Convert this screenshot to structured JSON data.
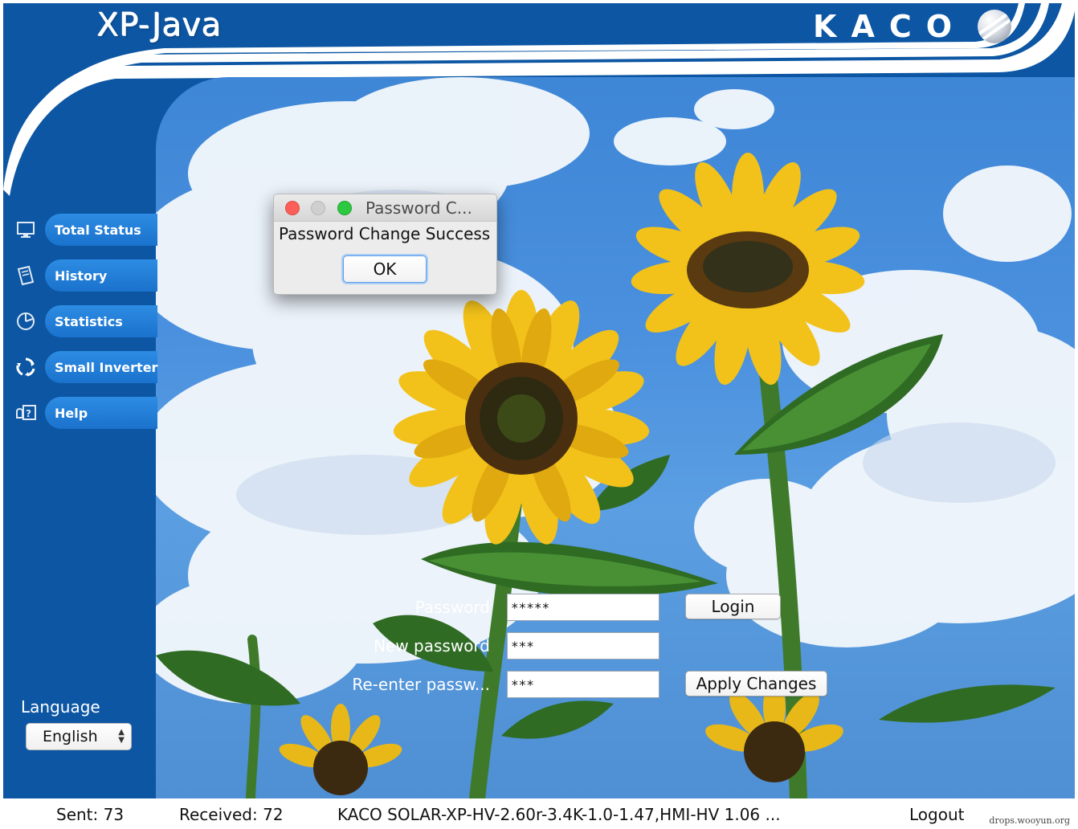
{
  "header": {
    "app_title": "XP-Java",
    "brand": "KACO"
  },
  "sidebar": {
    "items": [
      {
        "label": "Total Status",
        "icon": "monitor-icon"
      },
      {
        "label": "History",
        "icon": "history-icon"
      },
      {
        "label": "Statistics",
        "icon": "pie-chart-icon"
      },
      {
        "label": "Small Inverter",
        "icon": "recycle-icon"
      },
      {
        "label": "Help",
        "icon": "help-icon"
      }
    ],
    "language_label": "Language",
    "language_value": "English"
  },
  "form": {
    "password_label": "Password",
    "password_value": "*****",
    "new_password_label": "New password",
    "new_password_value": "***",
    "reenter_label": "Re-enter passw...",
    "reenter_value": "***",
    "login_button": "Login",
    "apply_button": "Apply Changes"
  },
  "dialog": {
    "title": "Password C...",
    "message": "Password Change Success",
    "ok_button": "OK"
  },
  "status": {
    "sent": "Sent:  73",
    "received": "Received:  72",
    "version": "KACO SOLAR-XP-HV-2.60r-3.4K-1.0-1.47,HMI-HV 1.06 ...",
    "logout": "Logout"
  },
  "watermark": "drops.wooyun.org",
  "colors": {
    "frame_blue": "#0c56a3",
    "nav_pill_blue": "#1a72cc",
    "close_red": "#fc5f57",
    "zoom_green": "#2bc840"
  }
}
